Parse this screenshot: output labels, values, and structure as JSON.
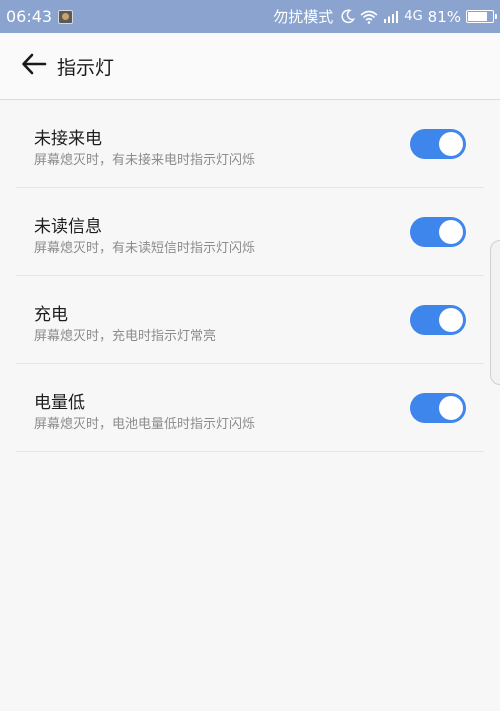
{
  "status_bar": {
    "time": "06:43",
    "dnd_label": "勿扰模式",
    "network": "4G",
    "battery": "81%",
    "battery_level": 0.81,
    "icons": [
      "app-notification-icon",
      "moon-icon",
      "wifi-icon",
      "signal-icon",
      "battery-icon"
    ]
  },
  "header": {
    "back_icon": "arrow-left-icon",
    "title": "指示灯"
  },
  "settings": [
    {
      "title": "未接来电",
      "description": "屏幕熄灭时，有未接来电时指示灯闪烁",
      "enabled": true
    },
    {
      "title": "未读信息",
      "description": "屏幕熄灭时，有未读短信时指示灯闪烁",
      "enabled": true
    },
    {
      "title": "充电",
      "description": "屏幕熄灭时，充电时指示灯常亮",
      "enabled": true
    },
    {
      "title": "电量低",
      "description": "屏幕熄灭时，电池电量低时指示灯闪烁",
      "enabled": true
    }
  ],
  "colors": {
    "status_bar": "#8aa3cf",
    "toggle_on": "#3f86ec",
    "background": "#f7f7f7"
  }
}
